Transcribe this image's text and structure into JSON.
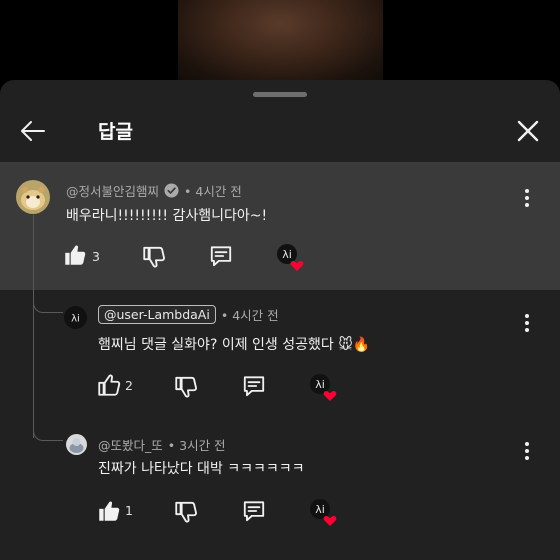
{
  "header": {
    "title": "답글"
  },
  "parent_comment": {
    "author": "@정서불안김햄찌",
    "time": "• 4시간 전",
    "text": "배우라니!!!!!!!!! 감사햄니다아~!",
    "likes": "3"
  },
  "replies": [
    {
      "mention": "@user-LambdaAi",
      "time": "• 4시간 전",
      "text": "햄찌님 댓글 실화야? 이제 인생 성공했다 🐭🔥",
      "likes": "2"
    },
    {
      "author": "@또봤다_또",
      "time": "• 3시간 전",
      "text": "진짜가 나타났다 대박 ㅋㅋㅋㅋㅋㅋ",
      "likes": "1"
    }
  ],
  "creator_badge_text": "λi",
  "colors": {
    "sheet_bg": "#212121",
    "highlight_bg": "#3a3a3a",
    "heart": "#ff0033"
  }
}
